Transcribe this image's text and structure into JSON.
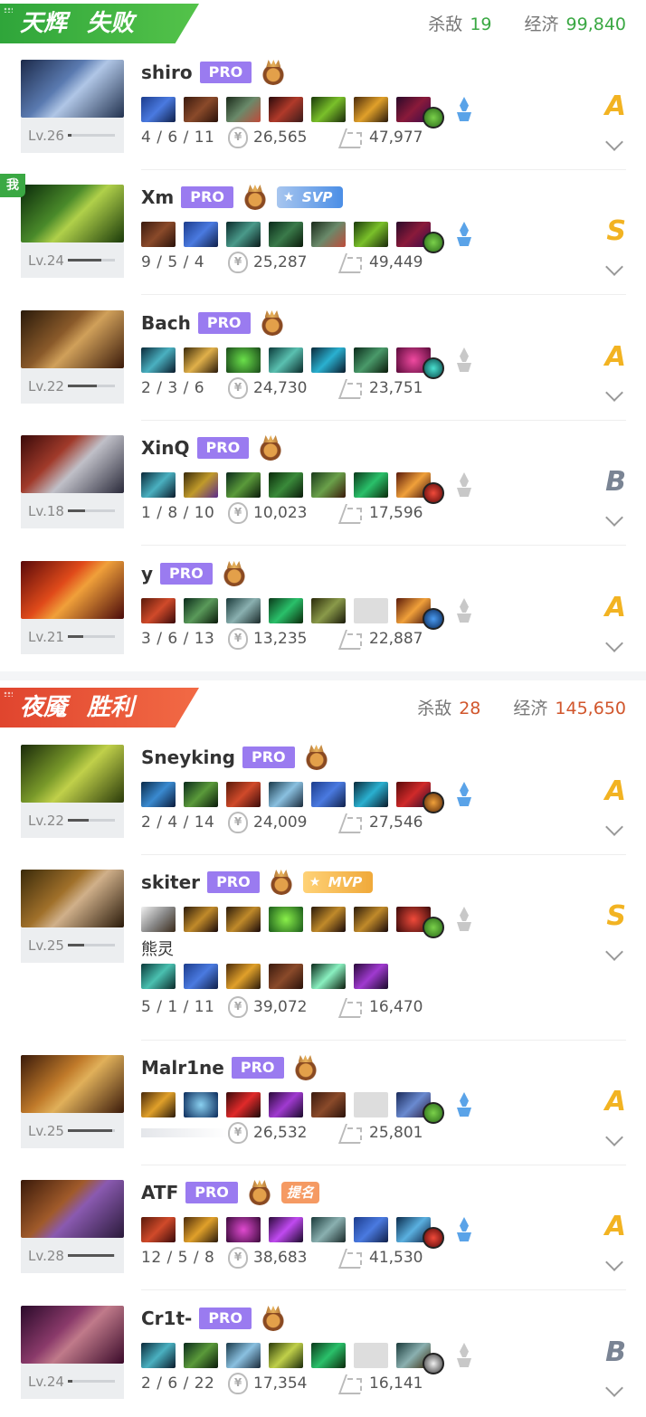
{
  "teams": [
    {
      "name": "天辉",
      "result": "失败",
      "kills_label": "杀敌",
      "kills": "19",
      "net_label": "经济",
      "net": "99,840",
      "players": [
        {
          "name": "shiro",
          "pro": "PRO",
          "level": "Lv.26",
          "level_fill": 0.08,
          "kda": "4 / 6 / 11",
          "net": "26,565",
          "damage": "47,977",
          "grade": "A"
        },
        {
          "name": "Xm",
          "pro": "PRO",
          "level": "Lv.24",
          "level_fill": 0.72,
          "me": "我",
          "badge": "SVP",
          "kda": "9 / 5 / 4",
          "net": "25,287",
          "damage": "49,449",
          "grade": "S"
        },
        {
          "name": "Bach",
          "pro": "PRO",
          "level": "Lv.22",
          "level_fill": 0.62,
          "kda": "2 / 3 / 6",
          "net": "24,730",
          "damage": "23,751",
          "grade": "A"
        },
        {
          "name": "XinQ",
          "pro": "PRO",
          "level": "Lv.18",
          "level_fill": 0.36,
          "kda": "1 / 8 / 10",
          "net": "10,023",
          "damage": "17,596",
          "grade": "B"
        },
        {
          "name": "y",
          "pro": "PRO",
          "level": "Lv.21",
          "level_fill": 0.32,
          "kda": "3 / 6 / 13",
          "net": "13,235",
          "damage": "22,887",
          "grade": "A"
        }
      ]
    },
    {
      "name": "夜魇",
      "result": "胜利",
      "kills_label": "杀敌",
      "kills": "28",
      "net_label": "经济",
      "net": "145,650",
      "players": [
        {
          "name": "Sneyking",
          "pro": "PRO",
          "level": "Lv.22",
          "level_fill": 0.45,
          "kda": "2 / 4 / 14",
          "net": "24,009",
          "damage": "27,546",
          "grade": "A"
        },
        {
          "name": "skiter",
          "pro": "PRO",
          "level": "Lv.25",
          "level_fill": 0.35,
          "badge": "MVP",
          "extra_label": "熊灵",
          "kda": "5 / 1 / 11",
          "net": "39,072",
          "damage": "16,470",
          "grade": "S"
        },
        {
          "name": "Malr1ne",
          "pro": "PRO",
          "level": "Lv.25",
          "level_fill": 0.95,
          "kda": "",
          "net": "26,532",
          "damage": "25,801",
          "grade": "A"
        },
        {
          "name": "ATF",
          "pro": "PRO",
          "level": "Lv.28",
          "level_fill": 0.98,
          "badge": "提名",
          "kda": "12 / 5 / 8",
          "net": "38,683",
          "damage": "41,530",
          "grade": "A"
        },
        {
          "name": "Cr1t-",
          "pro": "PRO",
          "level": "Lv.24",
          "level_fill": 0.1,
          "kda": "2 / 6 / 22",
          "net": "17,354",
          "damage": "16,141",
          "grade": "B"
        }
      ]
    }
  ],
  "icons": {
    "gold": "gold-coin-icon",
    "damage": "hero-damage-icon",
    "rank": "rank-medal-icon",
    "aghanim": "aghanims-scepter-icon",
    "expand": "chevron-down-icon"
  },
  "colors": {
    "radiant": "#3aa843",
    "dire": "#e0452e",
    "pro": "#9a7bf0",
    "grade_gold": "#f2b322",
    "grade_gray": "#7a8494"
  }
}
